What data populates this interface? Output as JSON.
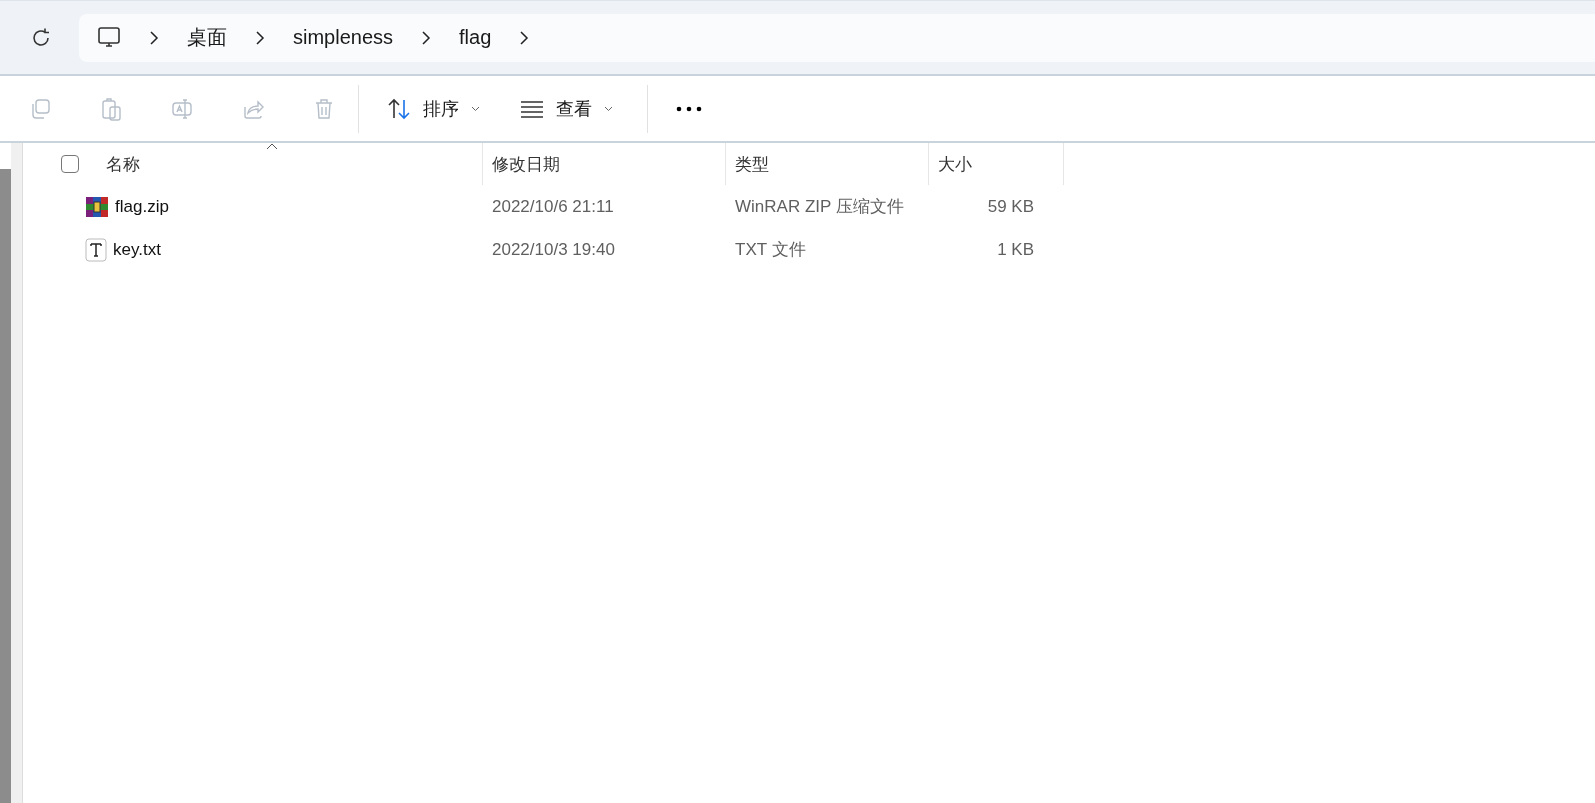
{
  "breadcrumb": [
    {
      "label": "桌面"
    },
    {
      "label": "simpleness"
    },
    {
      "label": "flag"
    }
  ],
  "toolbar": {
    "actions": [
      {
        "kind": "copy",
        "disabled": true
      },
      {
        "kind": "paste",
        "disabled": true
      },
      {
        "kind": "rename",
        "disabled": true
      },
      {
        "kind": "share",
        "disabled": true
      },
      {
        "kind": "delete",
        "disabled": true
      }
    ],
    "menus": [
      {
        "kind": "sort",
        "label": "排序"
      },
      {
        "kind": "view",
        "label": "查看"
      }
    ]
  },
  "columns": [
    {
      "label": "名称",
      "sorted": true
    },
    {
      "label": "修改日期",
      "sorted": false
    },
    {
      "label": "类型",
      "sorted": false
    },
    {
      "label": "大小",
      "sorted": false
    }
  ],
  "select_all": {
    "checked": false
  },
  "files": [
    {
      "kind": "zip",
      "name": "flag.zip",
      "modified": "2022/10/6 21:11",
      "type": "WinRAR ZIP 压缩文件",
      "size": "59 KB"
    },
    {
      "kind": "txt",
      "name": "key.txt",
      "modified": "2022/10/3 19:40",
      "type": "TXT 文件",
      "size": "1 KB"
    }
  ]
}
